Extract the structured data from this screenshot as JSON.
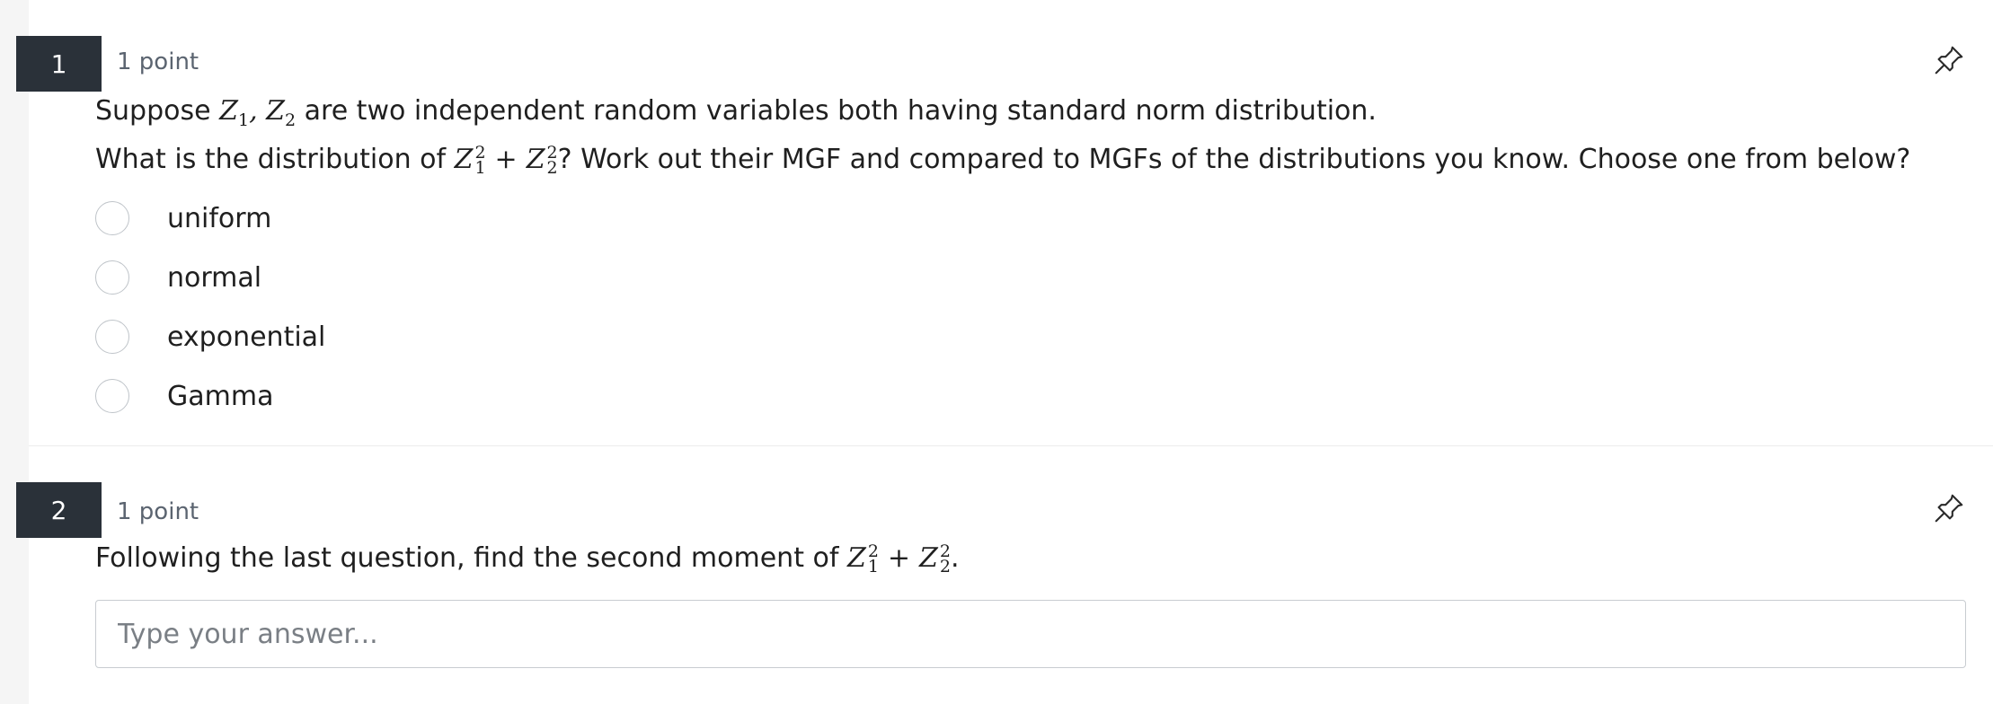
{
  "questions": [
    {
      "number": "1",
      "points": "1 point",
      "text_line1_before": "Suppose ",
      "text_line1_after": " are two independent random variables both having standard norm distribution.",
      "text_line2_before": "What is the distribution of ",
      "text_line2_after": "? Work out their MGF and compared to MGFs of the distributions you know. Choose one from below?",
      "options": [
        "uniform",
        "normal",
        "exponential",
        "Gamma"
      ],
      "pin_icon": "pin-icon"
    },
    {
      "number": "2",
      "points": "1 point",
      "text_before": "Following the last question, find the second moment of ",
      "text_after": ".",
      "answer_placeholder": "Type your answer...",
      "pin_icon": "pin-icon"
    }
  ],
  "colors": {
    "badge_bg": "#2a3139",
    "radio_border": "#bfc4c9",
    "muted_text": "#5b6470"
  }
}
